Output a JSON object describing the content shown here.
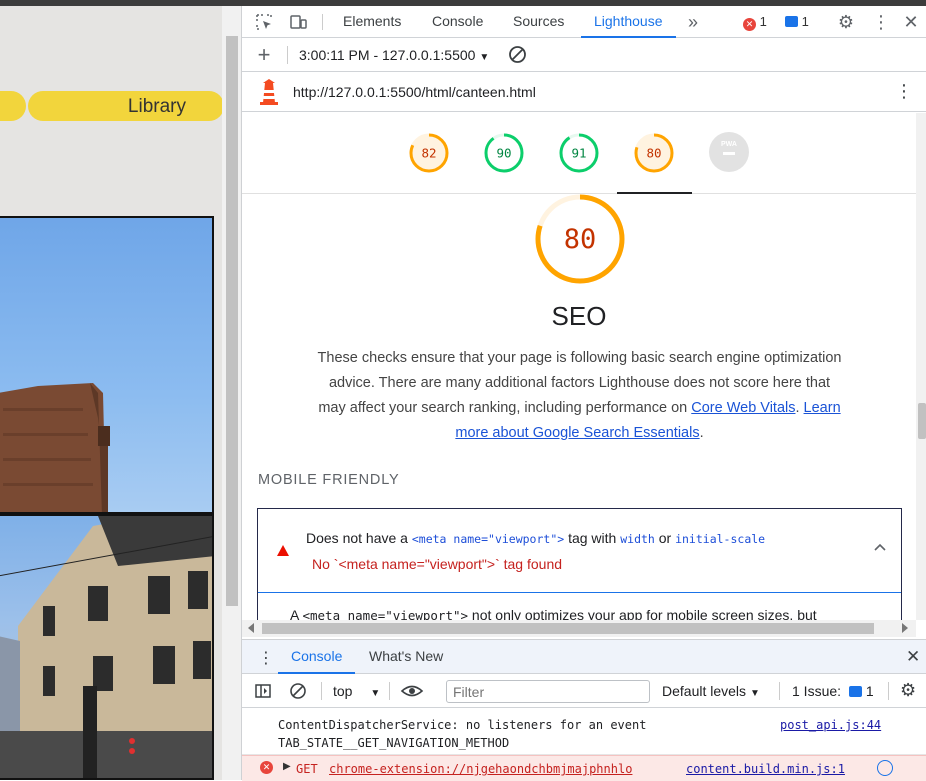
{
  "page": {
    "nav_label": "Library"
  },
  "devtools": {
    "tabs": [
      "Elements",
      "Console",
      "Sources",
      "Lighthouse"
    ],
    "more_tabs_icon": "double-chevron-icon",
    "error_count": "1",
    "message_count": "1"
  },
  "lighthouse": {
    "report_selector": "3:00:11 PM - 127.0.0.1:5500",
    "url": "http://127.0.0.1:5500/html/canteen.html",
    "scores": [
      {
        "value": 82,
        "color": "#ffa400",
        "text_color": "#c33300"
      },
      {
        "value": 90,
        "color": "#0cce6b",
        "text_color": "#018642"
      },
      {
        "value": 91,
        "color": "#0cce6b",
        "text_color": "#018642"
      },
      {
        "value": 80,
        "color": "#ffa400",
        "text_color": "#c33300"
      }
    ],
    "pwa_label": "PWA",
    "category": {
      "score": 80,
      "title": "SEO",
      "description": "These checks ensure that your page is following basic search engine optimization advice. There are many additional factors Lighthouse does not score here that may affect your search ranking, including performance on ",
      "link1": "Core Web Vitals",
      "sep": ". ",
      "link2": "Learn more about Google Search Essentials",
      "end": "."
    },
    "group_title": "MOBILE FRIENDLY",
    "audit": {
      "title_prefix": "Does not have a ",
      "title_code1": "<meta name=\"viewport\">",
      "title_mid": " tag with ",
      "title_code2": "width",
      "title_or": " or ",
      "title_code3": "initial-scale",
      "subtitle": "No `<meta name=\"viewport\">` tag found",
      "body_prefix": "A ",
      "body_code": "<meta name=\"viewport\">",
      "body_rest": " not only optimizes your app for mobile screen sizes, but"
    }
  },
  "drawer": {
    "tabs": [
      "Console",
      "What's New"
    ],
    "context": "top",
    "filter_placeholder": "Filter",
    "levels": "Default levels",
    "issues_label": "1 Issue:",
    "issues_count": "1",
    "message_line1": "ContentDispatcherService: no listeners for an event",
    "message_line2": "TAB_STATE__GET_NAVIGATION_METHOD",
    "message_source": "post_api.js:44",
    "error_method": "GET",
    "error_url": "chrome-extension://njgehaondchbmjmajphnhlo",
    "error_source": "content.build.min.js:1"
  },
  "colors": {
    "accent": "#1a73e8",
    "average": "#ffa400",
    "pass": "#0cce6b",
    "fail": "#eb0f00"
  }
}
